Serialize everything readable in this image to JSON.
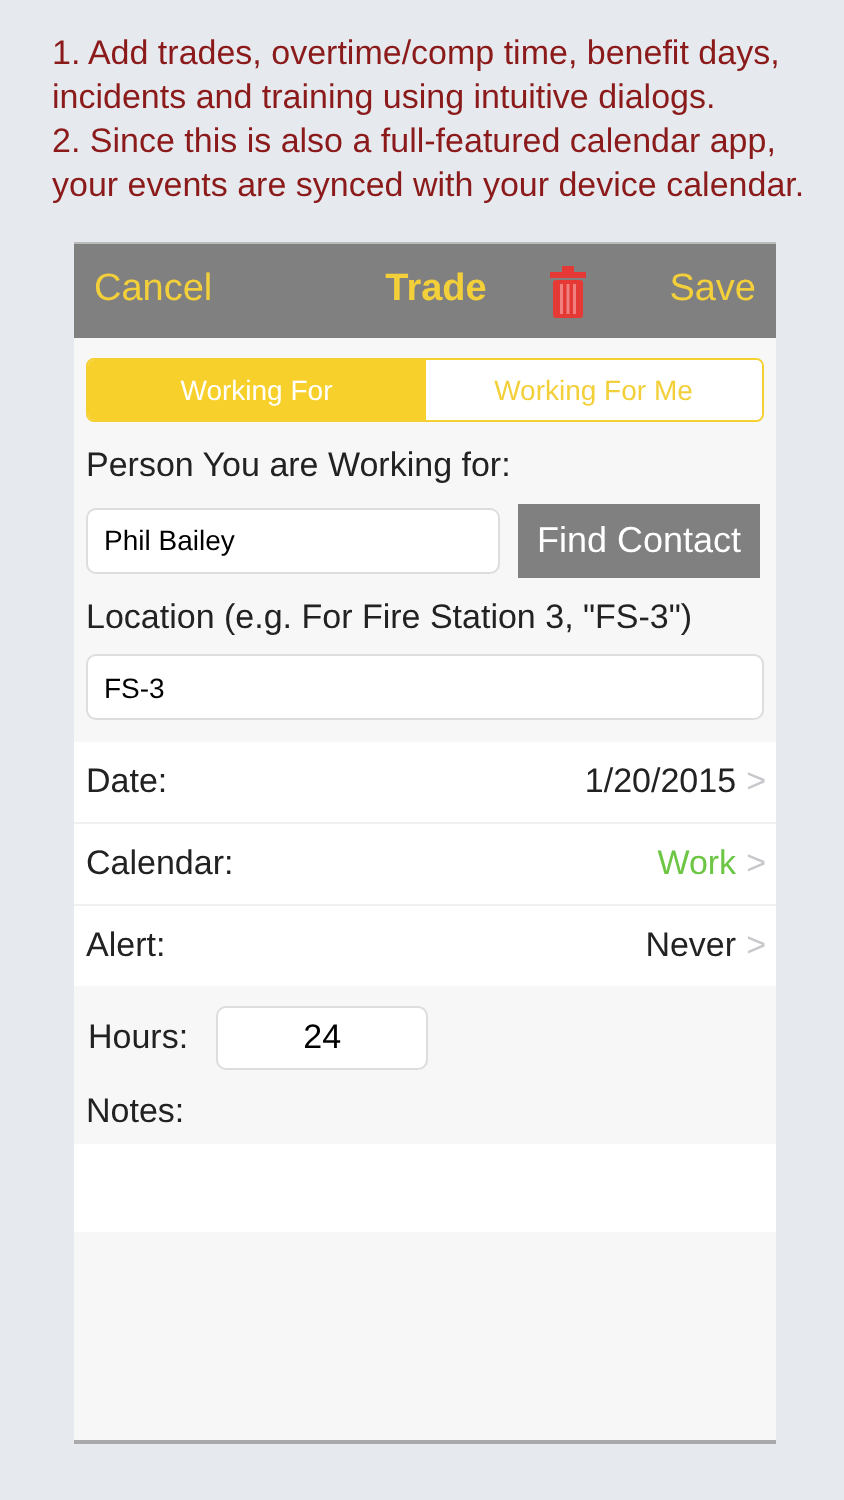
{
  "caption": [
    "1. Add trades, overtime/comp time, benefit days, incidents and training using intuitive dialogs.",
    "2. Since this is also a full-featured calendar app, your events are synced with your device calendar."
  ],
  "nav": {
    "cancel": "Cancel",
    "title": "Trade",
    "save": "Save"
  },
  "segments": [
    {
      "label": "Working For",
      "selected": true
    },
    {
      "label": "Working For Me",
      "selected": false
    }
  ],
  "person": {
    "label": "Person You are Working for:",
    "value": "Phil Bailey",
    "button": "Find Contact"
  },
  "location": {
    "label": "Location (e.g. For Fire Station 3, \"FS-3\")",
    "value": "FS-3"
  },
  "rows": [
    {
      "label": "Date:",
      "value": "1/20/2015",
      "color": "#222222",
      "chevron": ">"
    },
    {
      "label": "Calendar:",
      "value": "Work",
      "color": "#6cc644",
      "chevron": ">"
    },
    {
      "label": "Alert:",
      "value": "Never",
      "color": "#222222",
      "chevron": ">"
    }
  ],
  "hours": {
    "label": "Hours:",
    "value": "24"
  },
  "notes": {
    "label": "Notes:"
  }
}
